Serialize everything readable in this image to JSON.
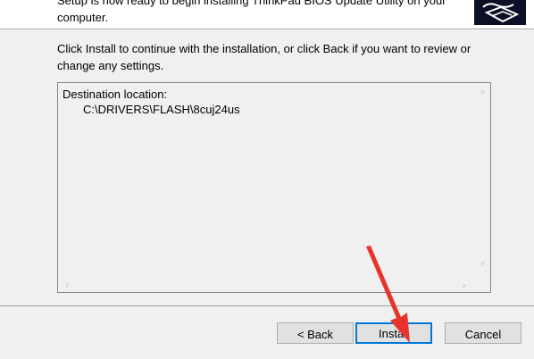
{
  "header": {
    "text": "Setup is now ready to begin installing ThinkPad BIOS Update Utility on your computer.",
    "logo_icon": "installer-logo-icon"
  },
  "main": {
    "instructions": "Click Install to continue with the installation, or click Back if you want to review or change any settings.",
    "memo": {
      "heading": "Destination location:",
      "path": "C:\\DRIVERS\\FLASH\\8cuj24us"
    }
  },
  "footer": {
    "back_label": "< Back",
    "install_label": "Install",
    "cancel_label": "Cancel"
  },
  "annotation": {
    "color": "#e8322b",
    "target": "install-button"
  }
}
